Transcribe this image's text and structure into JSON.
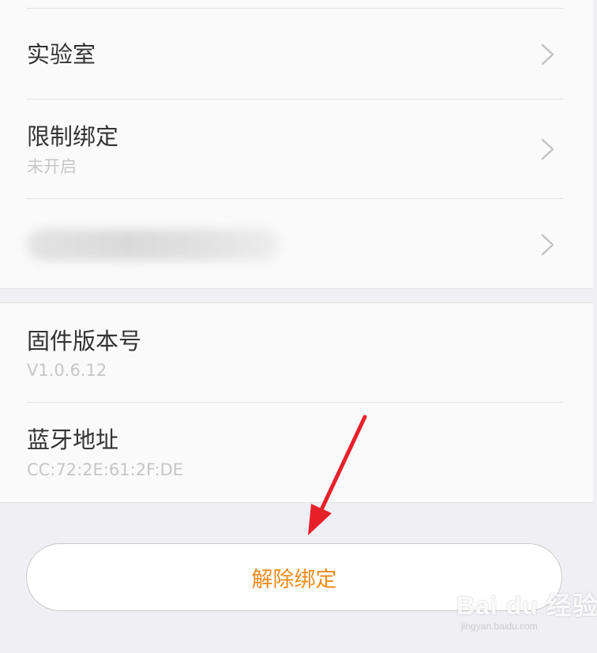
{
  "settings": {
    "rows": [
      {
        "title": "实验室"
      },
      {
        "title": "限制绑定",
        "subtitle": "未开启"
      },
      {
        "title": ""
      }
    ],
    "info": [
      {
        "title": "固件版本号",
        "value": "V1.0.6.12"
      },
      {
        "title": "蓝牙地址",
        "value": "CC:72:2E:61:2F:DE"
      }
    ]
  },
  "unbind_button": {
    "label": "解除绑定",
    "color": "#f08a1c"
  },
  "watermark": {
    "logo": "Bai du 经验",
    "url": "jingyan.baidu.com"
  },
  "icons": {
    "chevron": "chevron-right-icon",
    "annotation": "red-arrow-icon"
  }
}
